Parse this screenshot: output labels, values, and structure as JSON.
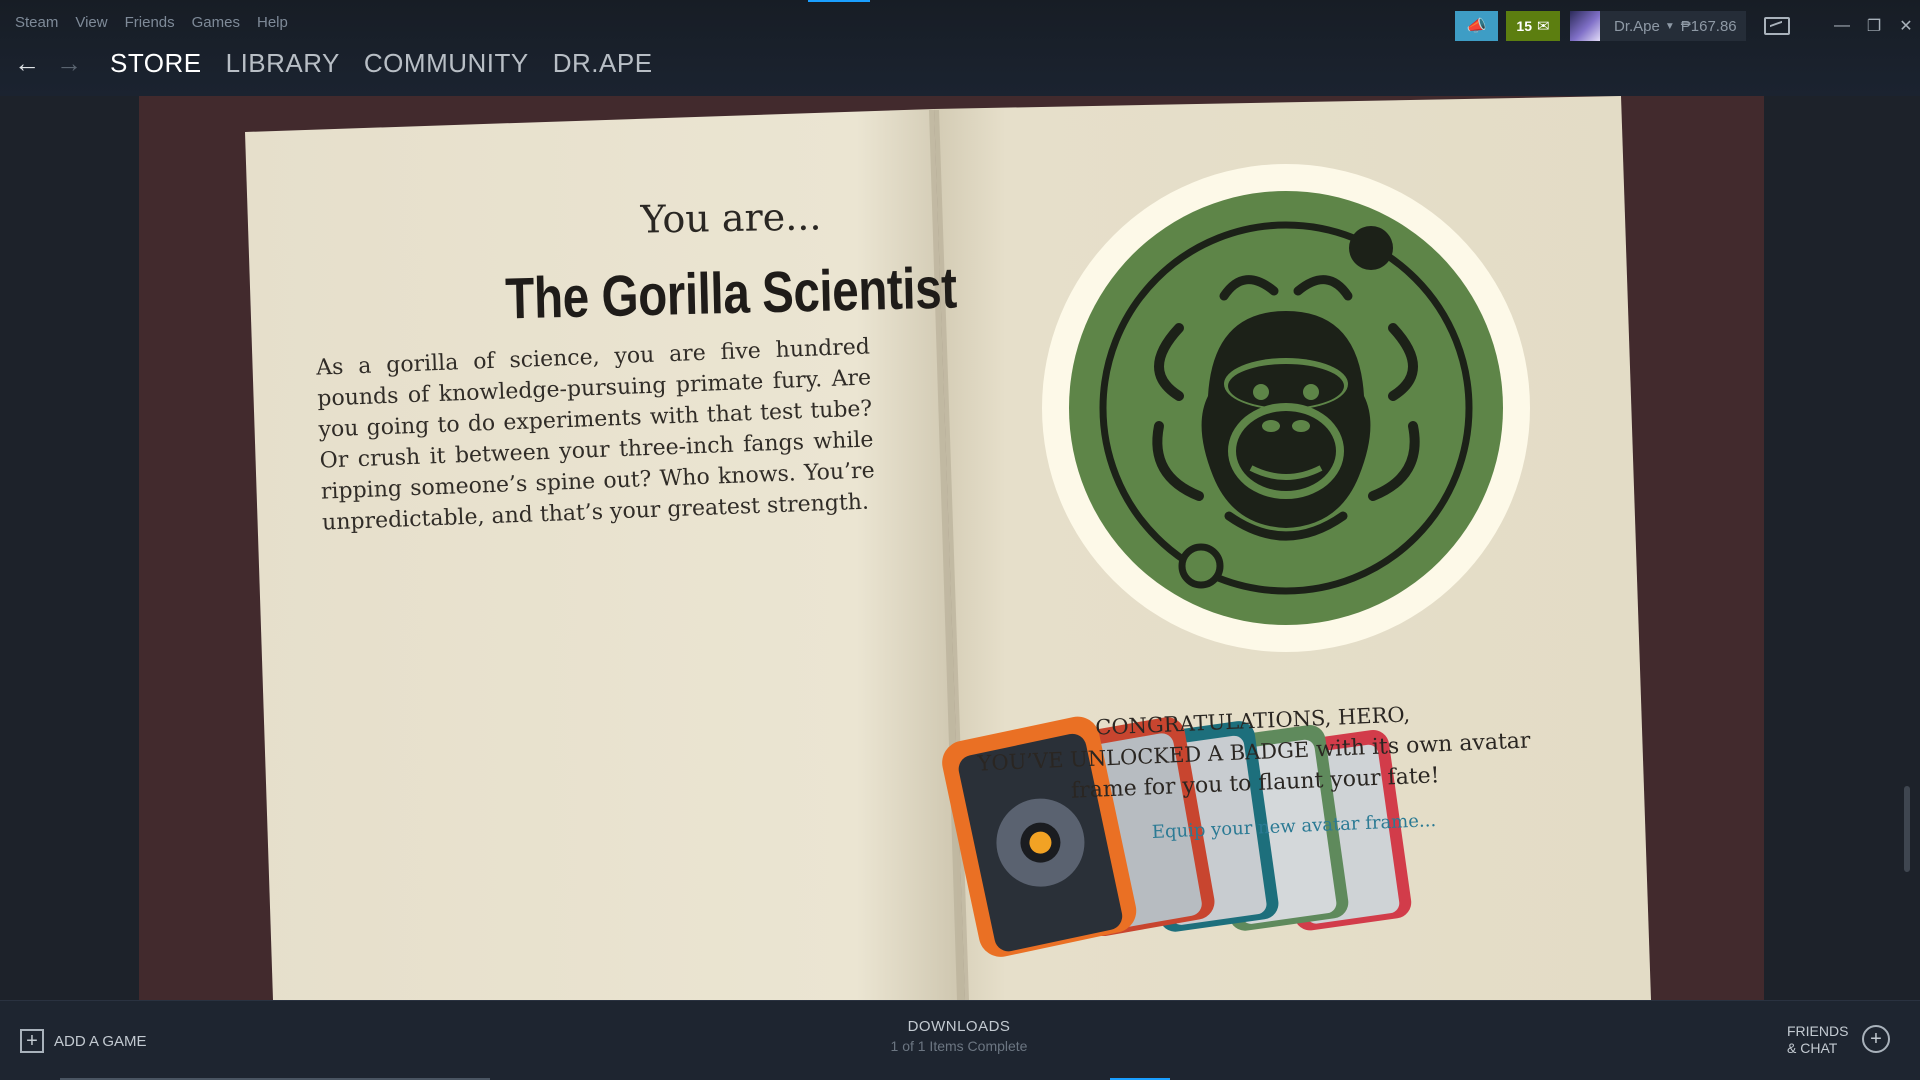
{
  "menu": [
    "Steam",
    "View",
    "Friends",
    "Games",
    "Help"
  ],
  "nav": {
    "tabs": [
      {
        "label": "STORE",
        "active": true
      },
      {
        "label": "LIBRARY",
        "active": false
      },
      {
        "label": "COMMUNITY",
        "active": false
      },
      {
        "label": "DR.APE",
        "active": false
      }
    ]
  },
  "header": {
    "notification_count": "15",
    "user_name": "Dr.Ape",
    "wallet": "₱167.86"
  },
  "page": {
    "intro": "You are...",
    "persona": "The Gorilla Scientist",
    "description": "As a gorilla of science, you are five hundred pounds of knowledge-pursuing primate fury. Are you going to do experiments with that test tube? Or crush it between your three-inch fangs while ripping someone’s spine out? Who knows. You’re unpredictable, and that’s your greatest strength.",
    "congrats_line1": "CONGRATULATIONS, HERO,",
    "congrats_line2_caps": "YOU’VE UNLOCKED A BADGE",
    "congrats_line2_rest": " with its own avatar frame for you to flaunt your fate!",
    "equip_link": "Equip your new avatar frame..."
  },
  "bottom": {
    "add_game": "ADD A GAME",
    "downloads_title": "DOWNLOADS",
    "downloads_status": "1 of 1 Items Complete",
    "friends_line1": "FRIENDS",
    "friends_line2": "& CHAT"
  },
  "colors": {
    "accent_blue": "#1a9fff",
    "notification_green": "#5c7e10",
    "announce_blue": "#3e9dc5",
    "badge_green": "#5e8548",
    "link_teal": "#2b7a94",
    "store_bg": "#422a2d"
  }
}
